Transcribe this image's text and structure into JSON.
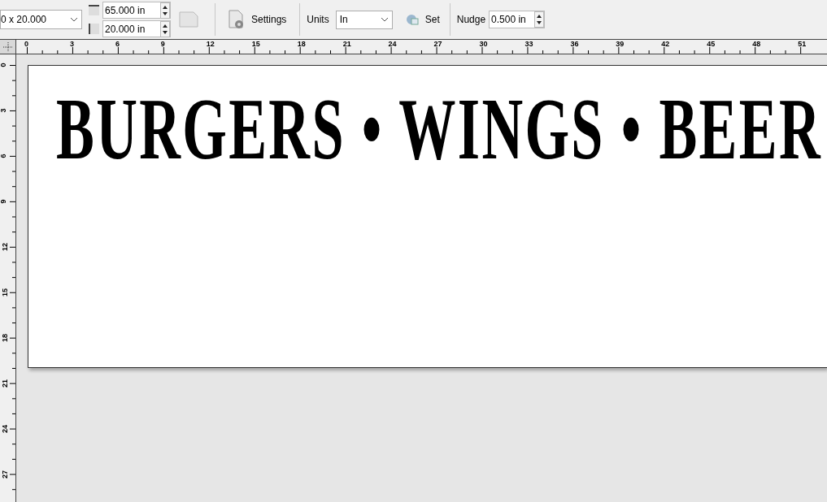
{
  "toolbar": {
    "size_preset": "0 x 20.000",
    "width": "65.000 in",
    "height": "20.000 in",
    "settings_label": "Settings",
    "units_label": "Units",
    "units_value": "In",
    "set_label": "Set",
    "nudge_label": "Nudge",
    "nudge_value": "0.500 in"
  },
  "ruler": {
    "horizontal": [
      "0",
      "3",
      "6",
      "9",
      "12",
      "15",
      "18",
      "21",
      "24",
      "27",
      "30",
      "33",
      "36",
      "39",
      "42",
      "45",
      "48",
      "51"
    ],
    "vertical": [
      "0",
      "3",
      "6",
      "9",
      "12",
      "15",
      "18",
      "21",
      "24",
      "27"
    ]
  },
  "page": {
    "text": "BURGERS • WINGS • BEER"
  }
}
